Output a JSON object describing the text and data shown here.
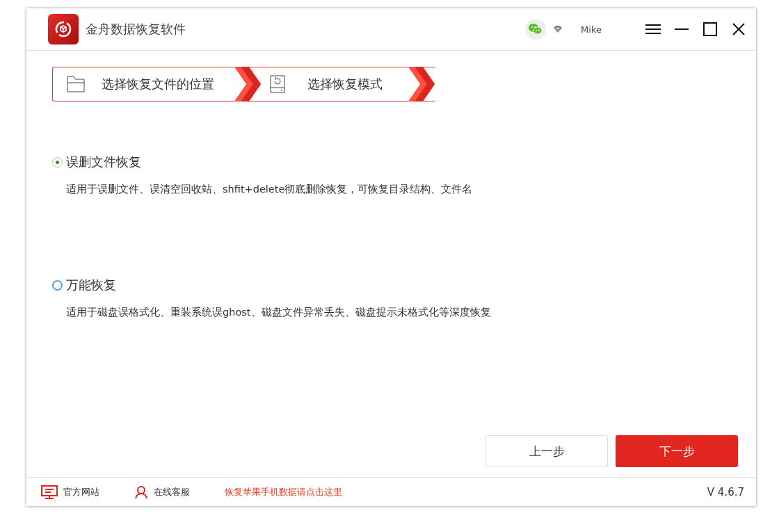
{
  "window": {
    "title": "金舟数据恢复软件",
    "user": "Mike"
  },
  "steps": [
    {
      "kind": "folder",
      "label": "选择恢复文件的位置"
    },
    {
      "kind": "disk",
      "label": "选择恢复模式"
    }
  ],
  "options": [
    {
      "label": "误删文件恢复",
      "description": "适用于误删文件、误清空回收站、shfit+delete彻底删除恢复，可恢复目录结构、文件名",
      "selected": true
    },
    {
      "label": "万能恢复",
      "description": "适用于磁盘误格式化、重装系统误ghost、磁盘文件异常丢失、磁盘提示未格式化等深度恢复",
      "selected": false
    }
  ],
  "buttons": {
    "back": "上一步",
    "next": "下一步"
  },
  "footer": {
    "website": "官方网站",
    "support": "在线客服",
    "promo": "恢复苹果手机数据请点击这里",
    "version": "V 4.6.7"
  }
}
